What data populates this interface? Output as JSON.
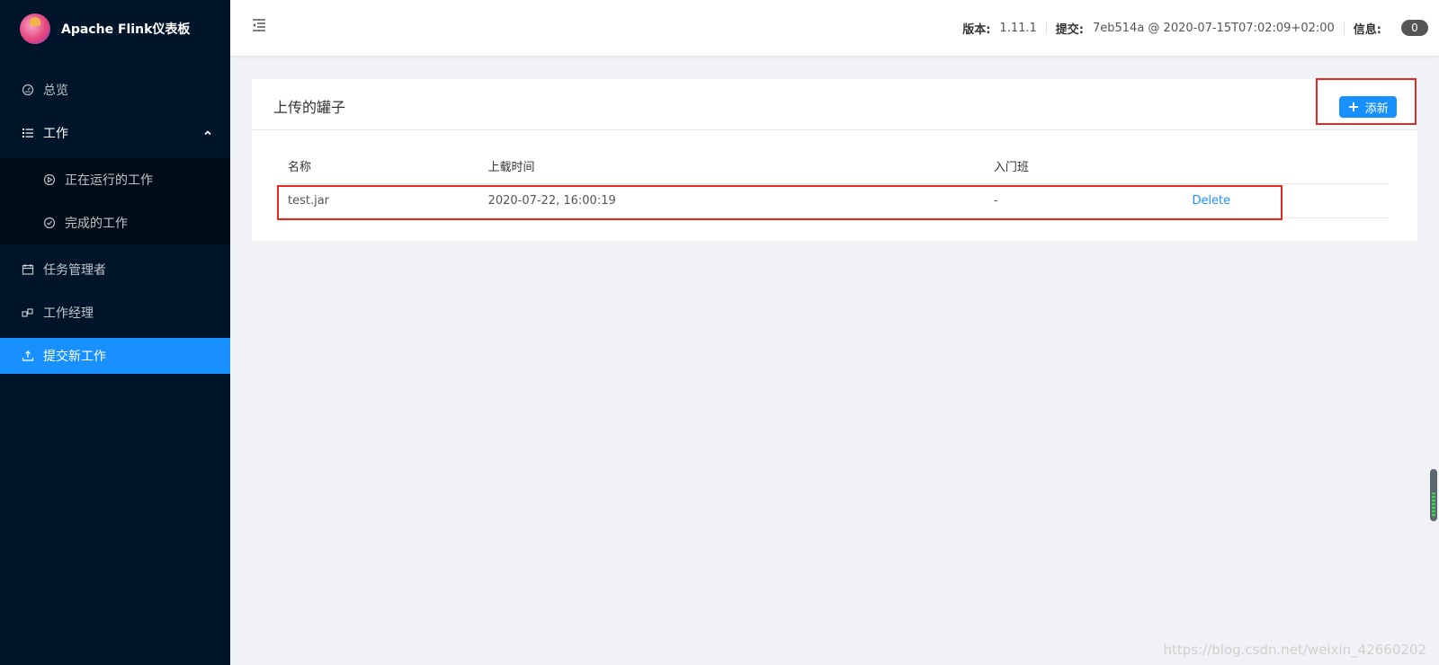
{
  "app": {
    "title": "Apache Flink仪表板"
  },
  "sidebar": {
    "items": [
      {
        "label": "总览",
        "icon": "dashboard-icon"
      },
      {
        "label": "工作",
        "icon": "list-icon",
        "expanded": true,
        "children": [
          {
            "label": "正在运行的工作",
            "icon": "play-circle-icon"
          },
          {
            "label": "完成的工作",
            "icon": "check-circle-icon"
          }
        ]
      },
      {
        "label": "任务管理者",
        "icon": "calendar-icon"
      },
      {
        "label": "工作经理",
        "icon": "cluster-icon"
      },
      {
        "label": "提交新工作",
        "icon": "upload-icon",
        "active": true
      }
    ],
    "colors": {
      "background": "#001529",
      "submenu_bg": "#000c17",
      "active": "#1890ff"
    }
  },
  "header": {
    "version_label": "版本:",
    "version_value": "1.11.1",
    "commit_label": "提交:",
    "commit_value": "7eb514a @ 2020-07-15T07:02:09+02:00",
    "info_label": "信息:",
    "info_count": "0"
  },
  "main": {
    "card_title": "上传的罐子",
    "add_button": "添新",
    "table": {
      "headers": [
        "名称",
        "上载时间",
        "入门班",
        ""
      ],
      "rows": [
        {
          "name": "test.jar",
          "upload_time": "2020-07-22, 16:00:19",
          "entry_class": "-",
          "action": "Delete"
        }
      ]
    }
  },
  "watermark": "https://blog.csdn.net/weixin_42660202",
  "colors": {
    "accent": "#1890ff",
    "highlight": "#e8271f"
  }
}
